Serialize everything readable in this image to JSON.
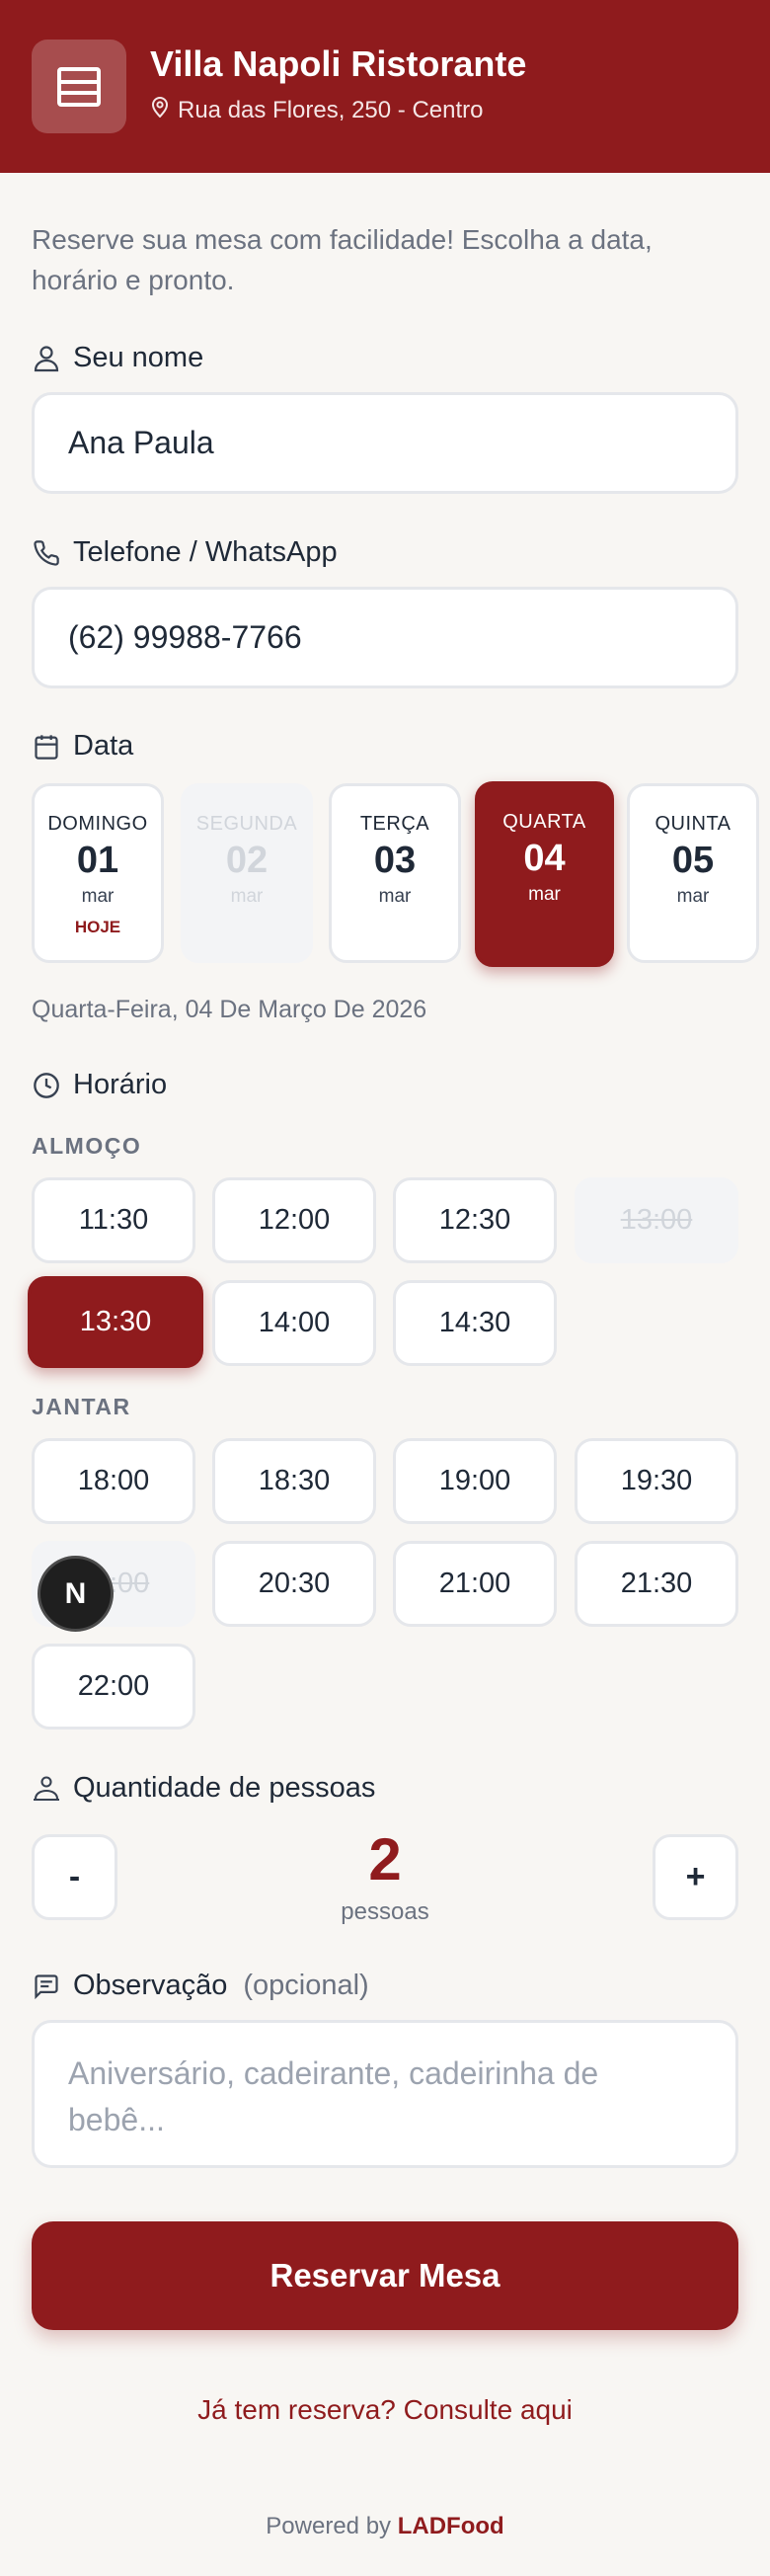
{
  "header": {
    "title": "Villa Napoli Ristorante",
    "address": "Rua das Flores, 250 - Centro"
  },
  "intro": "Reserve sua mesa com facilidade! Escolha a data, horário e pronto.",
  "name_field": {
    "label": "Seu nome",
    "value": "Ana Paula"
  },
  "phone_field": {
    "label": "Telefone / WhatsApp",
    "value": "(62) 99988-7766"
  },
  "date": {
    "label": "Data",
    "cards": [
      {
        "dow": "DOMINGO",
        "day": "01",
        "month": "mar",
        "badge": "HOJE",
        "state": "normal"
      },
      {
        "dow": "SEGUNDA",
        "day": "02",
        "month": "mar",
        "badge": "",
        "state": "disabled"
      },
      {
        "dow": "TERÇA",
        "day": "03",
        "month": "mar",
        "badge": "",
        "state": "normal"
      },
      {
        "dow": "QUARTA",
        "day": "04",
        "month": "mar",
        "badge": "",
        "state": "selected"
      },
      {
        "dow": "QUINTA",
        "day": "05",
        "month": "mar",
        "badge": "",
        "state": "normal"
      }
    ],
    "selected_text": "Quarta-Feira, 04 De Março De 2026"
  },
  "time": {
    "label": "Horário",
    "lunch_label": "ALMOÇO",
    "lunch": [
      {
        "time": "11:30",
        "state": "normal"
      },
      {
        "time": "12:00",
        "state": "normal"
      },
      {
        "time": "12:30",
        "state": "normal"
      },
      {
        "time": "13:00",
        "state": "disabled"
      },
      {
        "time": "13:30",
        "state": "selected"
      },
      {
        "time": "14:00",
        "state": "normal"
      },
      {
        "time": "14:30",
        "state": "normal"
      }
    ],
    "dinner_label": "JANTAR",
    "dinner": [
      {
        "time": "18:00",
        "state": "normal"
      },
      {
        "time": "18:30",
        "state": "normal"
      },
      {
        "time": "19:00",
        "state": "normal"
      },
      {
        "time": "19:30",
        "state": "normal"
      },
      {
        "time": "20:00",
        "state": "disabled"
      },
      {
        "time": "20:30",
        "state": "normal"
      },
      {
        "time": "21:00",
        "state": "normal"
      },
      {
        "time": "21:30",
        "state": "normal"
      },
      {
        "time": "22:00",
        "state": "normal"
      }
    ]
  },
  "dev_badge": "N",
  "guests": {
    "label": "Quantidade de pessoas",
    "minus": "-",
    "plus": "+",
    "count": "2",
    "unit": "pessoas"
  },
  "notes": {
    "label": "Observação",
    "optional": "(opcional)",
    "placeholder": "Aniversário, cadeirante, cadeirinha de bebê..."
  },
  "submit_label": "Reservar Mesa",
  "lookup_link": "Já tem reserva? Consulte aqui",
  "footer": {
    "prefix": "Powered by",
    "brand": "LADFood"
  },
  "colors": {
    "primary": "#8f1b1d",
    "background": "#f8f6f3"
  }
}
